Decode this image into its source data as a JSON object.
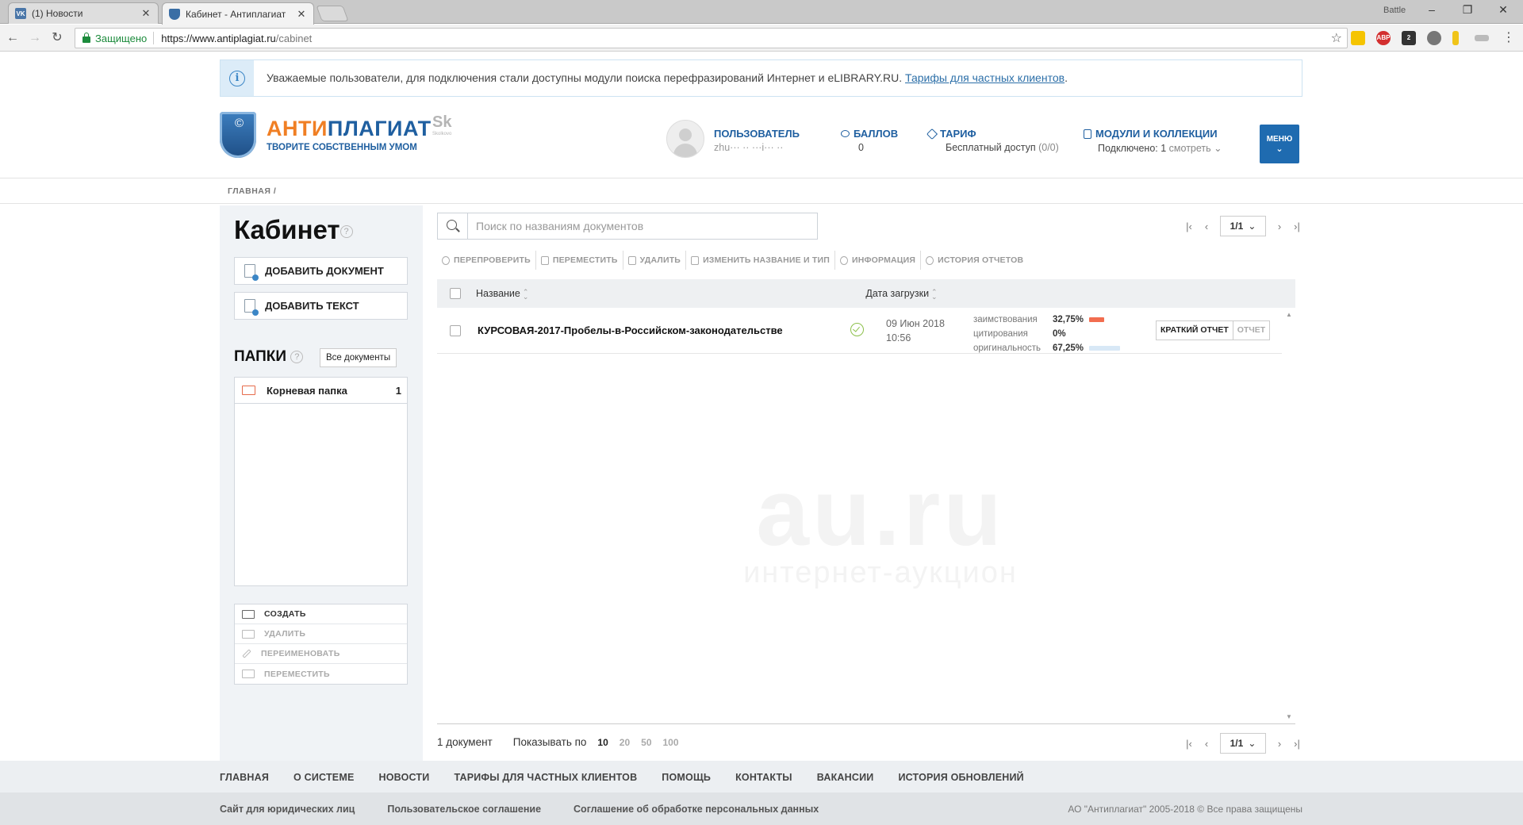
{
  "browser": {
    "tabs": [
      {
        "title": "(1) Новости",
        "favicon": "vk-icon"
      },
      {
        "title": "Кабинет - Антиплагиат",
        "favicon": "shield-icon"
      }
    ],
    "window_user": "Battle",
    "secure_label": "Защищено",
    "url_host": "https://www.antiplagiat.ru",
    "url_path": "/cabinet"
  },
  "notice": {
    "text": "Уважаемые пользователи, для подключения стали доступны модули поиска перефразирований Интернет и eLIBRARY.RU.",
    "link": "Тарифы для частных клиентов",
    "tail": "."
  },
  "header": {
    "logo_part1": "АНТИ",
    "logo_part2": "ПЛАГИАТ",
    "logo_tagline": "ТВОРИТЕ СОБСТВЕННЫМ УМОМ",
    "skolkovo": "Sk",
    "skolkovo_sub": "Skolkovo",
    "user_label": "ПОЛЬЗОВАТЕЛЬ",
    "user_value": "zhu··· ·· ···i··· ··",
    "points_label": "БАЛЛОВ",
    "points_value": "0",
    "tariff_label": "ТАРИФ",
    "tariff_value": "Бесплатный доступ",
    "tariff_extra": "(0/0)",
    "modules_label": "МОДУЛИ И КОЛЛЕКЦИИ",
    "modules_value": "Подключено: 1",
    "modules_link": "смотреть",
    "menu_label": "МЕНЮ"
  },
  "breadcrumb": "ГЛАВНАЯ /",
  "sidebar": {
    "title": "Кабинет",
    "add_document": "ДОБАВИТЬ ДОКУМЕНТ",
    "add_text": "ДОБАВИТЬ ТЕКСТ",
    "folders_title": "ПАПКИ",
    "all_docs": "Все документы",
    "folders": [
      {
        "name": "Корневая папка",
        "count": "1"
      }
    ],
    "actions": {
      "create": "СОЗДАТЬ",
      "delete": "УДАЛИТЬ",
      "rename": "ПЕРЕИМЕНОВАТЬ",
      "move": "ПЕРЕМЕСТИТЬ"
    }
  },
  "search": {
    "placeholder": "Поиск по названиям документов"
  },
  "pager": {
    "current": "1",
    "total": "1"
  },
  "toolbar": {
    "recheck": "ПЕРЕПРОВЕРИТЬ",
    "move": "ПЕРЕМЕСТИТЬ",
    "delete": "УДАЛИТЬ",
    "rename": "ИЗМЕНИТЬ НАЗВАНИЕ И ТИП",
    "info": "ИНФОРМАЦИЯ",
    "history": "ИСТОРИЯ ОТЧЕТОВ"
  },
  "table": {
    "col_name": "Название",
    "col_date": "Дата загрузки",
    "rows": [
      {
        "name": "КУРСОВАЯ-2017-Пробелы-в-Российском-законодательстве",
        "date": "09 Июн 2018",
        "time": "10:56",
        "borrow_label": "заимствования",
        "borrow_pct": "32,75%",
        "borrow_value": 32.75,
        "cite_label": "цитирования",
        "cite_pct": "0%",
        "cite_value": 0,
        "orig_label": "оригинальность",
        "orig_pct": "67,25%",
        "orig_value": 67.25,
        "short_report": "КРАТКИЙ ОТЧЕТ",
        "report": "ОТЧЕТ"
      }
    ]
  },
  "watermark": {
    "line1": "au.ru",
    "line2": "интернет-аукцион"
  },
  "footer_count": {
    "count": "1 документ",
    "per_page_label": "Показывать по",
    "sizes": [
      "10",
      "20",
      "50",
      "100"
    ]
  },
  "footer_nav": [
    "ГЛАВНАЯ",
    "О СИСТЕМЕ",
    "НОВОСТИ",
    "ТАРИФЫ ДЛЯ ЧАСТНЫХ КЛИЕНТОВ",
    "ПОМОЩЬ",
    "КОНТАКТЫ",
    "ВАКАНСИИ",
    "ИСТОРИЯ ОБНОВЛЕНИЙ"
  ],
  "footer_legal": {
    "links": [
      "Сайт для юридических лиц",
      "Пользовательское соглашение",
      "Соглашение об обработке персональных данных"
    ],
    "copyright": "АО \"Антиплагиат\" 2005-2018 © Все права защищены"
  },
  "colors": {
    "brand_blue": "#1f5fa0",
    "brand_orange": "#f07f24",
    "borrow_bar": "#f26d4f",
    "orig_bar": "#d8e8f6"
  }
}
